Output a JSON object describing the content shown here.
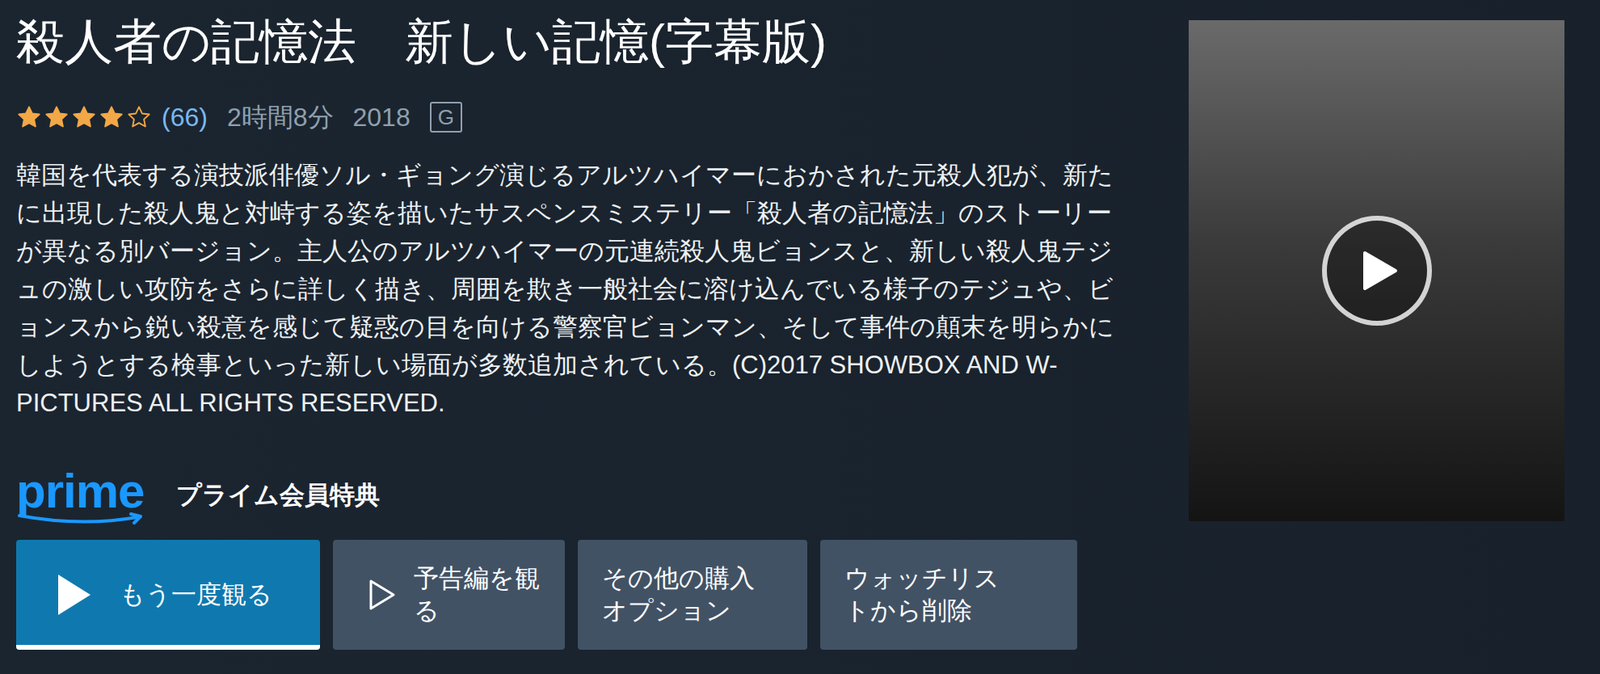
{
  "title": "殺人者の記憶法　新しい記憶(字幕版)",
  "rating": {
    "stars": 4,
    "max": 5,
    "count": "(66)"
  },
  "duration": "2時間8分",
  "year": "2018",
  "age_rating": "G",
  "description": "韓国を代表する演技派俳優ソル・ギョング演じるアルツハイマーにおかされた元殺人犯が、新たに出現した殺人鬼と対峙する姿を描いたサスペンスミステリー「殺人者の記憶法」のストーリーが異なる別バージョン。主人公のアルツハイマーの元連続殺人鬼ビョンスと、新しい殺人鬼テジュの激しい攻防をさらに詳しく描き、周囲を欺き一般社会に溶け込んでいる様子のテジュや、ビョンスから鋭い殺意を感じて疑惑の目を向ける警察官ビョンマン、そして事件の顛末を明らかにしようとする検事といった新しい場面が多数追加されている。(C)2017 SHOWBOX AND W-PICTURES ALL RIGHTS RESERVED.",
  "prime": {
    "logo": "prime",
    "label": "プライム会員特典"
  },
  "buttons": [
    {
      "label": "もう一度観る",
      "kind": "primary",
      "progress": 1
    },
    {
      "label": "予告編を観る",
      "kind": "trailer",
      "progress": 0
    },
    {
      "label": "その他の購入オプション",
      "kind": "plain",
      "progress": 0
    },
    {
      "label": "ウォッチリストから削除",
      "kind": "plain",
      "progress": 0
    }
  ]
}
